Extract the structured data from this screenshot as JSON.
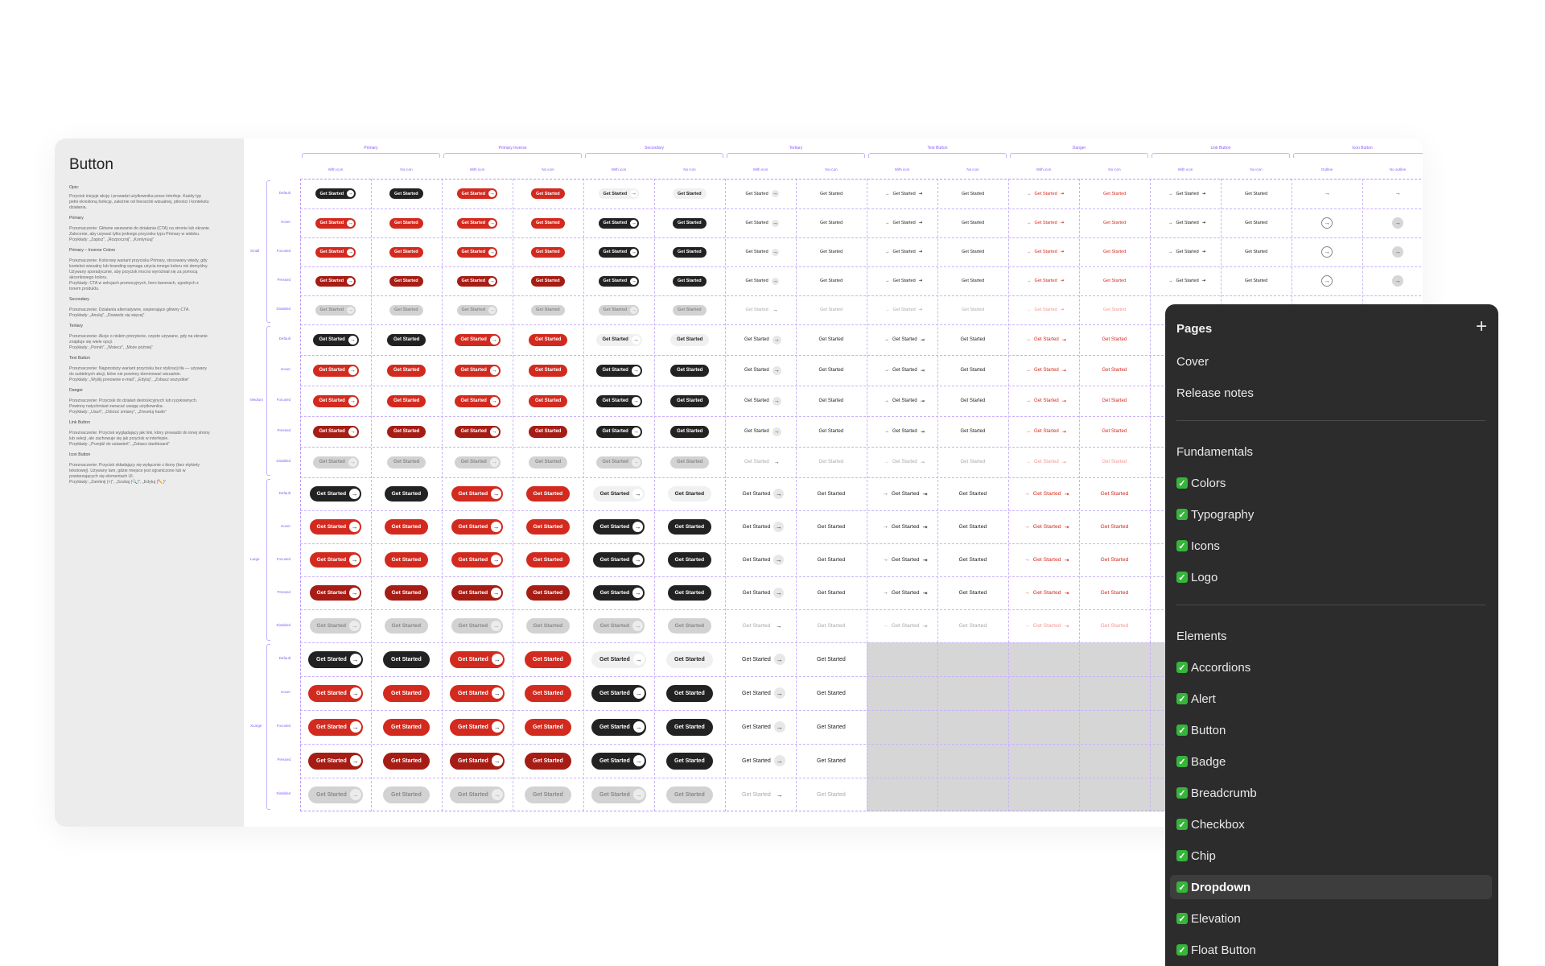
{
  "docs": {
    "title": "Button",
    "blocks": [
      {
        "head": "Opis:",
        "lines": [
          "Przycisk inicjuje akcję i prowadzi użytkownika przez interfejs. Każdy typ",
          "pełni określoną funkcję, zależnie od hierarchii wizualnej, pilności i kontekstu",
          "działania."
        ]
      },
      {
        "head": "Primary",
        "lines": []
      },
      {
        "head": "",
        "lines": [
          "Przeznaczenie: Główne wezwanie do działania (CTA) na stronie lub ekranie.",
          "Zalecenie, aby używać tylko jednego przycisku typu Primary w widoku.",
          "Przykłady: „Zapisz”, „Rozpocznij”, „Kontynuuj”"
        ]
      },
      {
        "head": "Primary – Inverse Colors",
        "lines": []
      },
      {
        "head": "",
        "lines": [
          "Przeznaczenie: Kolorowy wariant przycisku Primary, stosowany wtedy, gdy",
          "kontekst wizualny lub branding wymaga użycia innego koloru niż domyślny.",
          "Używany sporadycznie, aby przycisk mocno wyróżniał się za pomocą",
          "akcentowego koloru.",
          "Przykłady: CTA w sekcjach promocyjnych, hero banerach, zgodnych z",
          "tonem produktu."
        ]
      },
      {
        "head": "Secondary",
        "lines": []
      },
      {
        "head": "",
        "lines": [
          "Przeznaczenie: Działania alternatywne, wspierające główny CTA.",
          "Przykłady: „Anuluj”, „Dowiedz się więcej”"
        ]
      },
      {
        "head": "Tertiary",
        "lines": []
      },
      {
        "head": "",
        "lines": [
          "Przeznaczenie: Akcje o niskim priorytecie, często używane, gdy na ekranie",
          "znajduje się wiele opcji.",
          "Przykłady: „Pomiń”, „Wstecz”, „Może później”"
        ]
      },
      {
        "head": "Text Button",
        "lines": []
      },
      {
        "head": "",
        "lines": [
          "Przeznaczenie: Najprostszy wariant przycisku bez stylizacji tła — używany",
          "do subtelnych akcji, które nie powinny dominować wizualnie.",
          "Przykłady: „Wyślij ponownie e-mail”, „Edytuj”, „Zobacz wszystkie”"
        ]
      },
      {
        "head": "Danger",
        "lines": []
      },
      {
        "head": "",
        "lines": [
          "Przeznaczenie: Przyciski do działań destrukcyjnych lub ryzykownych.",
          "Powinny natychmiast zwracać uwagę użytkownika.",
          "Przykłady: „Usuń”, „Odrzuć zmiany”, „Zresetuj hasło”"
        ]
      },
      {
        "head": "Link Button",
        "lines": []
      },
      {
        "head": "",
        "lines": [
          "Przeznaczenie: Przycisk wyglądający jak link, który prowadzi do innej strony",
          "lub sekcji, ale zachowuje się jak przycisk w interfejsie.",
          "Przykłady: „Przejdź do ustawień”, „Zobacz dashboard”"
        ]
      },
      {
        "head": "Icon Button",
        "lines": []
      },
      {
        "head": "",
        "lines": [
          "Przeznaczenie: Przycisk składający się wyłącznie z ikony (bez etykiety",
          "tekstowej). Używany tam, gdzie miejsce jest ograniczone lub w",
          "powtarzających się elementach UI.",
          "Przykłady: „Zamknij (×)”, „Szukaj (🔍)”, „Edytuj (✏️)”"
        ]
      }
    ]
  },
  "matrix": {
    "groups": [
      "Primary",
      "Primary Inverse",
      "Secondary",
      "Tertiary",
      "Text Button",
      "Danger",
      "Link Button",
      "Icon Button"
    ],
    "columns": [
      "With icon",
      "No icon",
      "With icon",
      "No icon",
      "With icon",
      "No icon",
      "With icon",
      "No icon",
      "With icon",
      "No icon",
      "With icon",
      "No icon",
      "With icon",
      "No icon",
      "Outline",
      "No outline"
    ],
    "sizes": [
      "Small",
      "Medium",
      "Large",
      "XLarge"
    ],
    "states": [
      "Default",
      "Hover",
      "Focused",
      "Pressed",
      "Disabled"
    ],
    "button_label": "Get Started",
    "arrow_glyph": "→",
    "text_arrow_glyph": "→",
    "exit_glyph": "⇥",
    "colors": {
      "red": "#d32a1f",
      "dark": "#222222",
      "accent": "#8a5cf6"
    }
  },
  "pages_panel": {
    "title": "Pages",
    "add_icon": "+",
    "top_items": [
      "Cover",
      "Release notes"
    ],
    "sections": [
      {
        "title": "Fundamentals",
        "items": [
          "Colors",
          "Typography",
          "Icons",
          "Logo"
        ]
      },
      {
        "title": "Elements",
        "items": [
          "Accordions",
          "Alert",
          "Button",
          "Badge",
          "Breadcrumb",
          "Checkbox",
          "Chip",
          "Dropdown",
          "Elevation",
          "Float Button"
        ]
      }
    ],
    "active_item": "Dropdown",
    "check_glyph": "✓"
  }
}
